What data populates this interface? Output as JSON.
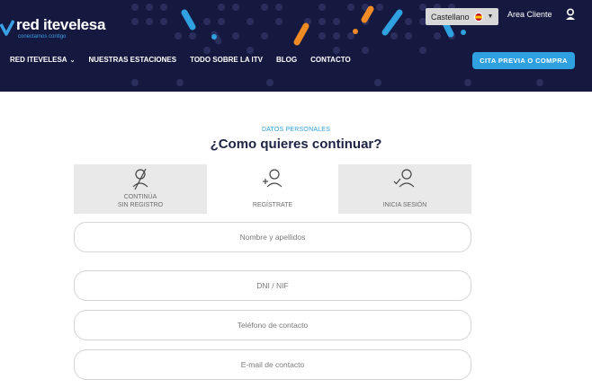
{
  "brand": {
    "name_part1": "red ",
    "name_part2": "itevelesa",
    "slogan": "conectamos contigo"
  },
  "header": {
    "language": {
      "selected": "Castellano"
    },
    "account_link": "Area Cliente",
    "nav": [
      {
        "label": "RED ITEVELESA",
        "has_dropdown": true
      },
      {
        "label": "NUESTRAS ESTACIONES"
      },
      {
        "label": "TODO SOBRE LA ITV"
      },
      {
        "label": "BLOG"
      },
      {
        "label": "CONTACTO"
      }
    ],
    "cta_label": "CITA PREVIA O COMPRA"
  },
  "form": {
    "section_label": "DATOS PERSONALES",
    "title": "¿Como quieres continuar?",
    "options": [
      {
        "label": "CONTINÚA\nSIN REGISTRO",
        "icon": "no-user-icon",
        "selected": false
      },
      {
        "label": "REGÍSTRATE",
        "icon": "add-user-icon",
        "selected": true
      },
      {
        "label": "INICIA SESIÓN",
        "icon": "check-user-icon",
        "selected": false
      }
    ],
    "fields": [
      {
        "placeholder": "Nombre y apellidos"
      },
      {
        "placeholder": "DNI / NIF"
      },
      {
        "placeholder": "Teléfono de contacto"
      },
      {
        "placeholder": "E-mail de contacto"
      }
    ]
  },
  "colors": {
    "header_bg": "#16193f",
    "accent_blue": "#2fa0e0",
    "accent_orange": "#f08a24",
    "option_bg": "#e9e9e9"
  }
}
